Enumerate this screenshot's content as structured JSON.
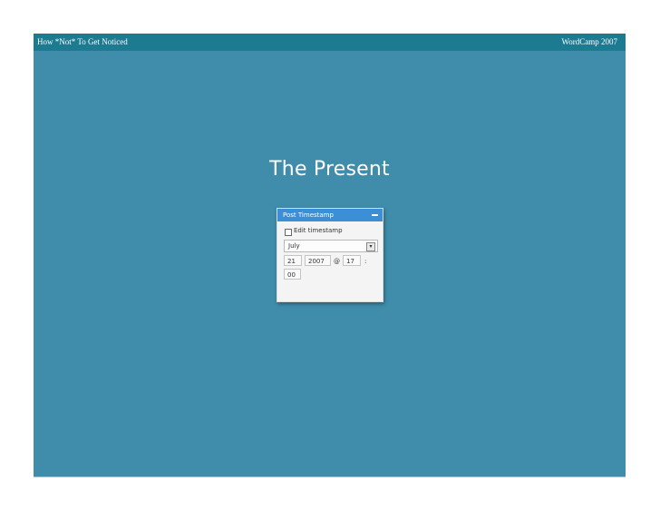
{
  "header": {
    "left_text": "How *Not* To Get Noticed",
    "right_text": "WordCamp 2007"
  },
  "slide": {
    "title": "The Present"
  },
  "widget": {
    "title": "Post Timestamp",
    "checkbox_label": "Edit timestamp",
    "month_selected": "July",
    "select_arrow_glyph": "▾",
    "day": "21",
    "year": "2007",
    "at_symbol": "@",
    "hour": "17",
    "colon": ":",
    "minute": "00"
  },
  "colors": {
    "slide_background": "#3f8dab",
    "header_bar": "#1c7a91",
    "widget_titlebar": "#3c8fd6"
  }
}
